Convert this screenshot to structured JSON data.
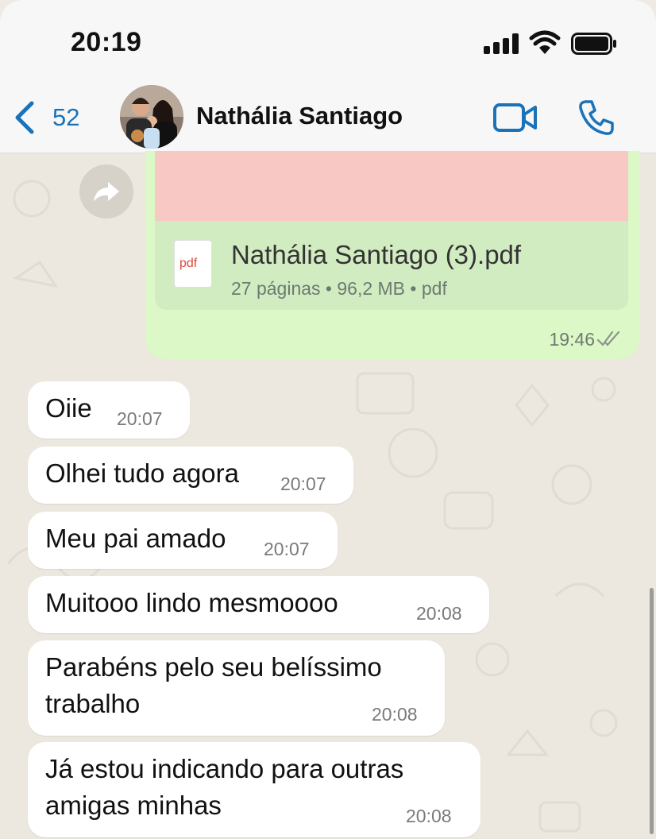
{
  "status_bar": {
    "time": "20:19"
  },
  "header": {
    "back_count": "52",
    "contact_name": "Nathália Santiago"
  },
  "document_message": {
    "file_name": "Nathália Santiago (3).pdf",
    "meta": "27 páginas • 96,2 MB • pdf",
    "icon_label": "pdf",
    "time": "19:46"
  },
  "messages": [
    {
      "text": "Oiie",
      "time": "20:07"
    },
    {
      "text": "Olhei tudo agora",
      "time": "20:07"
    },
    {
      "text": "Meu pai amado",
      "time": "20:07"
    },
    {
      "text": "Muitooo lindo mesmoooo",
      "time": "20:08"
    },
    {
      "text_line1": "Parabéns pelo seu belíssimo",
      "text_line2": "trabalho",
      "time": "20:08"
    },
    {
      "text_line1": "Já estou indicando para outras",
      "text_line2": "amigas minhas",
      "time": "20:08"
    }
  ],
  "colors": {
    "accent": "#1a73b8",
    "outgoing_bubble": "#dcf8c6",
    "incoming_bubble": "#ffffff",
    "chat_background": "#ece7df"
  }
}
